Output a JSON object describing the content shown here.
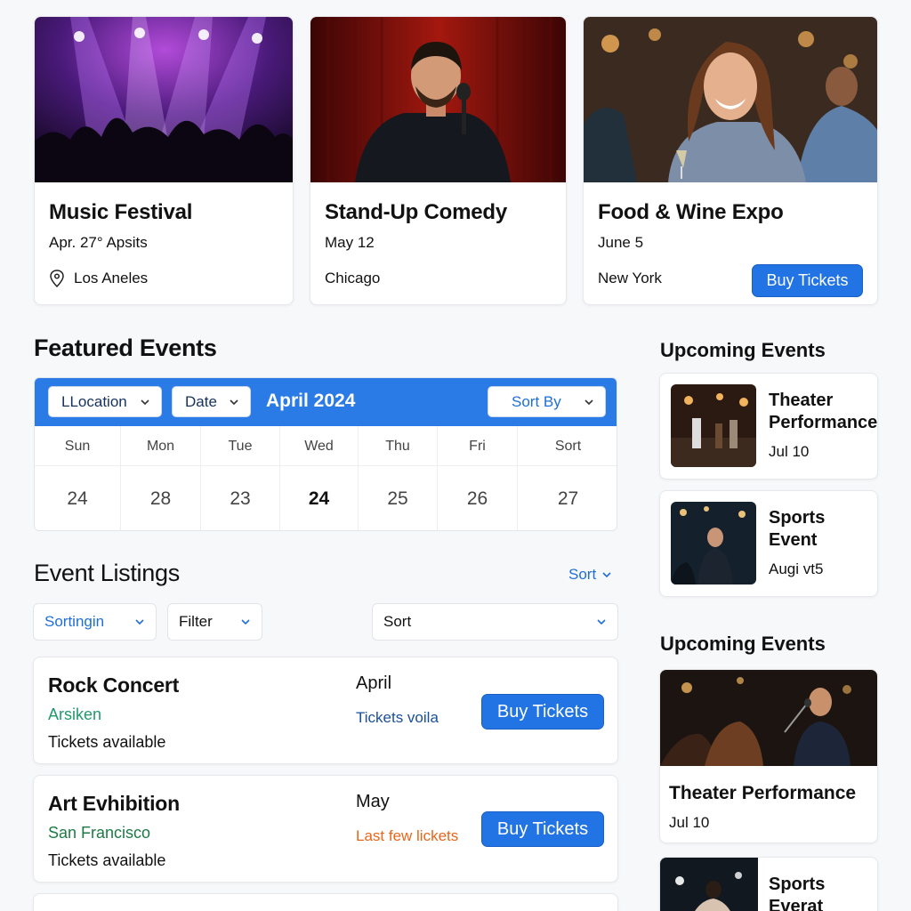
{
  "top_cards": [
    {
      "title": "Music Festival",
      "date": "Apr. 27°  Apsits",
      "location": "Los Aneles",
      "image": "concert-crowd"
    },
    {
      "title": "Stand-Up Comedy",
      "date": "May  12",
      "location": "Chicago",
      "image": "comedian-on-stage"
    },
    {
      "title": "Food & Wine Expo",
      "date": "June 5",
      "location": "New York",
      "image": "woman-with-wine",
      "button": "Buy Tickets"
    }
  ],
  "featured": {
    "title": "Featured Events",
    "filters": {
      "location": "LLocation",
      "date": "Date",
      "sort": "Sort By"
    },
    "month": "April 2024",
    "days": [
      {
        "name": "Sun",
        "num": "24"
      },
      {
        "name": "Mon",
        "num": "28"
      },
      {
        "name": "Tue",
        "num": "23"
      },
      {
        "name": "Wed",
        "num": "24"
      },
      {
        "name": "Thu",
        "num": "25"
      },
      {
        "name": "Fri",
        "num": "26"
      },
      {
        "name": "Sort",
        "num": "27"
      }
    ]
  },
  "listings": {
    "title": "Event Listings",
    "sort_link": "Sort",
    "filters": {
      "sorting": "Sortingin",
      "filter": "Filter",
      "sort": "Sort"
    },
    "items": [
      {
        "name": "Rock Concert",
        "city": "Arsiken",
        "availability": "Tickets  available",
        "month": "April",
        "status": "Tickets voila",
        "button": "Buy Tickets"
      },
      {
        "name": "Art Evhibition",
        "city": "San Francisco",
        "availability": "Tickets  available",
        "month": "May",
        "status": "Last few lickets",
        "button": "Buy Tickets"
      }
    ]
  },
  "sidebar": {
    "upcoming_title_1": "Upcoming Events",
    "upcoming_title_2": "Upcoming Events",
    "items": [
      {
        "title_line1": "Theater",
        "title_line2": "Performance",
        "date": "Jul 10",
        "image": "theater-stage"
      },
      {
        "title_line1": "Sports",
        "title_line2": "Event",
        "date": "Augi vt5",
        "image": "speaker-on-stage"
      }
    ],
    "feature": {
      "title": "Theater Performance",
      "date": "Jul 10",
      "image": "singer-with-microphone"
    },
    "bottom_item": {
      "title_line1": "Sports",
      "title_line2": "Everat",
      "image": "performer-spotlight"
    }
  },
  "colors": {
    "accent": "#2273e3",
    "green": "#1f9a6b",
    "orange": "#e8661a",
    "dark_blue": "#1a4f9c"
  }
}
